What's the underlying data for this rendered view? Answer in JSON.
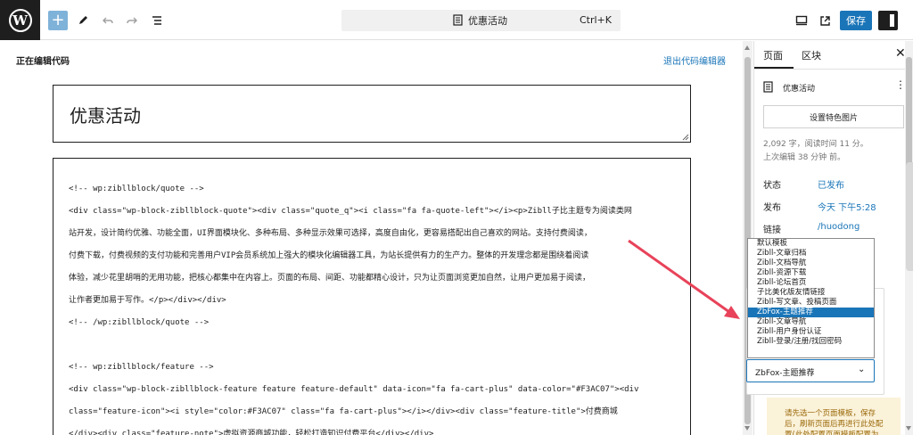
{
  "toolbar": {
    "doc_title": "优惠活动",
    "shortcut": "Ctrl+K",
    "save_label": "保存"
  },
  "editor": {
    "editing_label": "正在编辑代码",
    "exit_label": "退出代码编辑器",
    "post_title": "优惠活动",
    "code_lines": [
      "<!-- wp:zibllblock/quote -->",
      "<div class=\"wp-block-zibllblock-quote\"><div class=\"quote_q\"><i class=\"fa fa-quote-left\"></i><p>Zibll子比主题专为阅读类网",
      "站开发，设计简约优雅、功能全面，UI界面模块化、多种布局、多种显示效果可选择，高度自由化，更容易搭配出自己喜欢的网站。支持付费阅读，",
      "付费下载，付费视频的支付功能和完善用户VIP会员系统加上强大的模块化编辑器工具，为站长提供有力的生产力。整体的开发理念都是围绕着阅读",
      "体验，减少花里胡哨的无用功能，把核心都集中在内容上。页面的布局、间距、功能都精心设计，只为让页面浏览更加自然，让用户更加易于阅读，",
      "让作者更加易于写作。</p></div></div>",
      "<!-- /wp:zibllblock/quote -->",
      "",
      "<!-- wp:zibllblock/feature -->",
      "<div class=\"wp-block-zibllblock-feature feature feature-default\" data-icon=\"fa fa-cart-plus\" data-color=\"#F3AC07\"><div",
      "class=\"feature-icon\"><i style=\"color:#F3AC07\" class=\"fa fa-cart-plus\"></i></div><div class=\"feature-title\">付费商城",
      "</div><div class=\"feature-note\">虚拟资源商城功能，轻松打造知识付费平台</div></div>"
    ]
  },
  "sidebar": {
    "tab_page": "页面",
    "tab_block": "区块",
    "post_title": "优惠活动",
    "featured_image_label": "设置特色图片",
    "stats_line1": "2,092 字，阅读时间 11 分。",
    "stats_line2": "上次编辑 38 分钟 前。",
    "status_label": "状态",
    "status_value": "已发布",
    "publish_label": "发布",
    "publish_value": "今天 下午5:28",
    "link_label": "链接",
    "link_value": "/huodong",
    "template_options": [
      "默认模板",
      "Zibll-文章归档",
      "Zibll-文档导航",
      "Zibll-资源下载",
      "Zibll-论坛首页",
      "子比美化版友情链接",
      "Zibll-写文章、投稿页面",
      "ZbFox-主题推荐",
      "Zibll-文章导航",
      "Zibll-用户身份认证",
      "Zibll-登录/注册/找回密码"
    ],
    "template_selected_index": 7,
    "template_selected": "ZbFox-主题推荐",
    "notice_text": "请先选一个页面模板，保存后，刷新页面后再进行此处配置(此处配置页面模板配置为"
  },
  "colors": {
    "accent": "#1a75b8",
    "arrow": "#e8435a",
    "notice_bg": "#fbf2da"
  }
}
